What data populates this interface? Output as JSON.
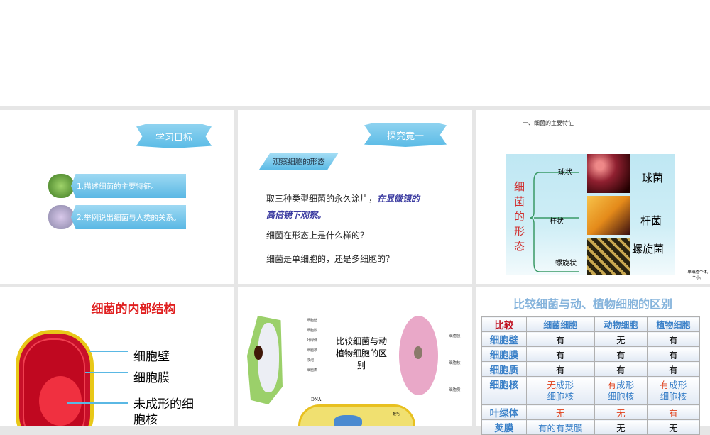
{
  "slide1": {
    "ribbon": "学习目标",
    "goals": [
      "1.描述细菌的主要特征。",
      "2.举例说出细菌与人类的关系。"
    ]
  },
  "slide2": {
    "ribbon": "探究竟一",
    "tag": "观察细胞的形态",
    "p1a": "取三种类型细菌的永久涂片，",
    "p1b": "在显微镜的高倍镜下观察。",
    "q1": "细菌在形态上是什么样的？",
    "q2": "细菌是单细胞的，还是多细胞的？"
  },
  "slide3": {
    "heading": "一、细菌的主要特征",
    "vertical": "细菌的形态",
    "shapes": [
      "球状",
      "杆状",
      "螺旋状"
    ],
    "names": [
      "球菌",
      "杆菌",
      "螺旋菌"
    ],
    "note": "单细胞个体,个小。"
  },
  "slide4": {
    "title": "细菌的内部结构",
    "labels": [
      "细胞壁",
      "细胞膜",
      "未成形的细胞核"
    ]
  },
  "slide5": {
    "center": "比较细菌与动植物细胞的区别",
    "plant_labels": [
      "细胞壁",
      "细胞膜",
      "叶绿体",
      "细胞核",
      "液泡",
      "细胞质"
    ],
    "animal_labels": [
      "细胞膜",
      "细胞核",
      "细胞质"
    ],
    "bact_labels": [
      "DNA",
      "鞭毛"
    ]
  },
  "slide6": {
    "title": "比较细菌与动、植物细胞的区别",
    "header": [
      "比较",
      "细菌细胞",
      "动物细胞",
      "植物细胞"
    ],
    "rows": [
      [
        "细胞壁",
        "有",
        "无",
        "有"
      ],
      [
        "细胞膜",
        "有",
        "有",
        "有"
      ],
      [
        "细胞质",
        "有",
        "有",
        "有"
      ],
      [
        "细胞核",
        "无|成形细胞核",
        "有|成形细胞核",
        "有|成形细胞核"
      ],
      [
        "叶绿体",
        "无",
        "无",
        "有"
      ],
      [
        "荚膜",
        "有的有荚膜",
        "无",
        "无"
      ]
    ]
  }
}
